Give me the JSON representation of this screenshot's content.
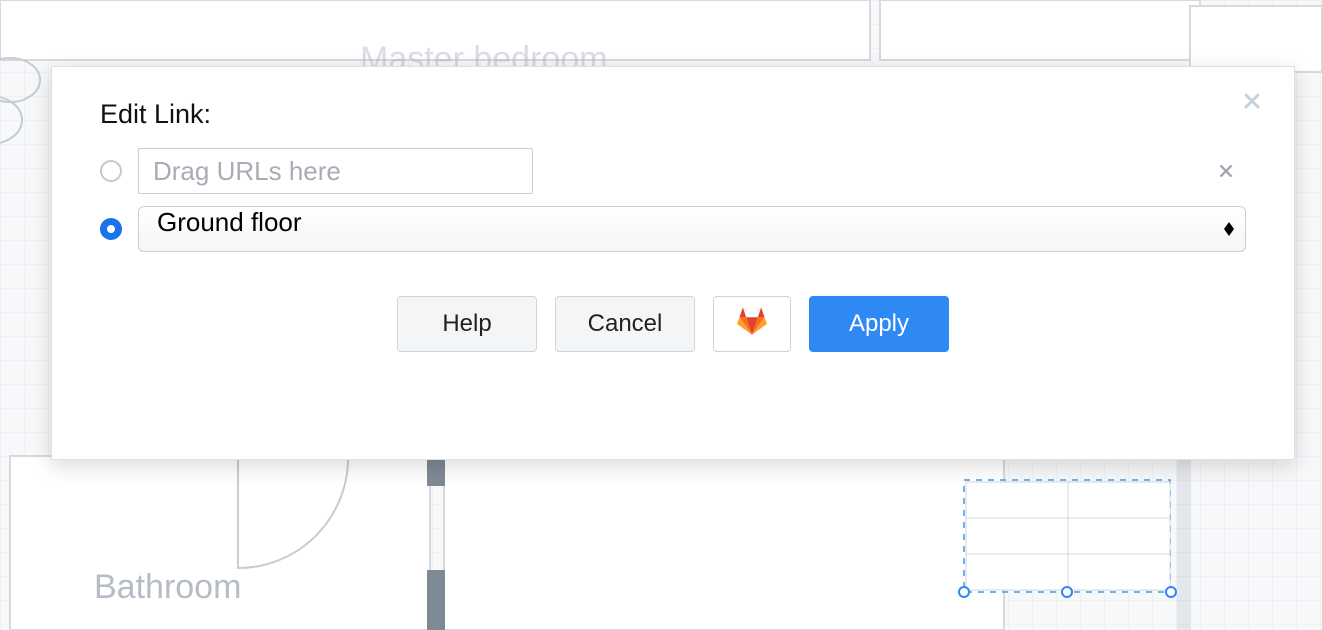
{
  "bg": {
    "master_bedroom_label": "Master bedroom",
    "bathroom_label": "Bathroom"
  },
  "dialog": {
    "title": "Edit Link:",
    "url_placeholder": "Drag URLs here",
    "url_value": "",
    "selected_page": "Ground floor",
    "buttons": {
      "help": "Help",
      "cancel": "Cancel",
      "apply": "Apply"
    }
  }
}
